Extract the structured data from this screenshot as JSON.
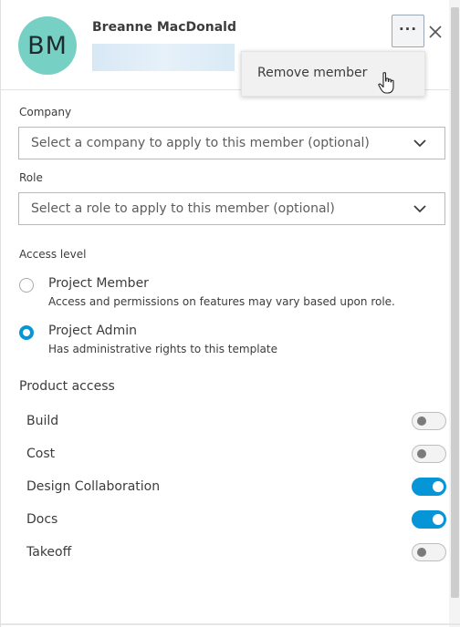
{
  "member": {
    "initials": "BM",
    "name": "Breanne MacDonald"
  },
  "header": {
    "more_label": "···",
    "close_label": "×"
  },
  "menu": {
    "items": [
      "Remove member"
    ]
  },
  "company": {
    "label": "Company",
    "placeholder": "Select a company to apply to this member (optional)"
  },
  "role": {
    "label": "Role",
    "placeholder": "Select a role to apply to this member (optional)"
  },
  "access": {
    "label": "Access level",
    "options": [
      {
        "title": "Project Member",
        "description": "Access and permissions on features may vary based upon role.",
        "selected": false
      },
      {
        "title": "Project Admin",
        "description": "Has administrative rights to this template",
        "selected": true
      }
    ]
  },
  "product_access": {
    "title": "Product access",
    "products": [
      {
        "name": "Build",
        "enabled": false
      },
      {
        "name": "Cost",
        "enabled": false
      },
      {
        "name": "Design Collaboration",
        "enabled": true
      },
      {
        "name": "Docs",
        "enabled": true
      },
      {
        "name": "Takeoff",
        "enabled": false
      }
    ]
  },
  "colors": {
    "avatar_bg": "#76d1c4",
    "accent": "#0696d7"
  }
}
